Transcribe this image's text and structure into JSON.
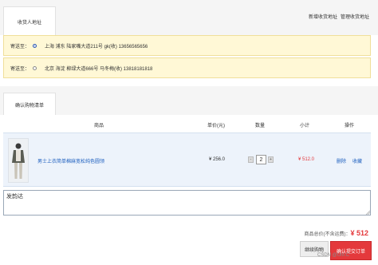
{
  "header": {
    "tab_label": "收货人地址",
    "link_add": "新增收货地址",
    "link_manage": "管理收货地址"
  },
  "addresses": [
    {
      "label": "寄送至：",
      "selected": true,
      "text": "上海 浦东 陆家嘴大道211号  gk(收)  13656565656"
    },
    {
      "label": "寄送至：",
      "selected": false,
      "text": "北京 海淀 柳绿大道666号  马冬梅(收)  13818181818"
    }
  ],
  "order_section": {
    "tab_label": "确认购物清单"
  },
  "table": {
    "headers": [
      "商品",
      "单价(元)",
      "数量",
      "小计",
      "操作"
    ],
    "row": {
      "name": "男士上衣简单棉麻宽松纯色圆领",
      "price": "¥ 256.0",
      "qty_minus": "-",
      "qty": "2",
      "qty_plus": "+",
      "subtotal": "¥ 512.0",
      "op_delete": "删除",
      "op_favorite": "收藏"
    }
  },
  "remark": {
    "value": "发韵达"
  },
  "summary": {
    "label": "商品总价(不含运费)：",
    "amount": "¥ 512"
  },
  "actions": {
    "continue": "继续购物",
    "submit": "确认提交订单"
  },
  "watermark": "CSDN @Unr.C",
  "colors": {
    "accent": "#e4393c",
    "link": "#1d5fbf",
    "address_bg": "#fff8d6"
  }
}
